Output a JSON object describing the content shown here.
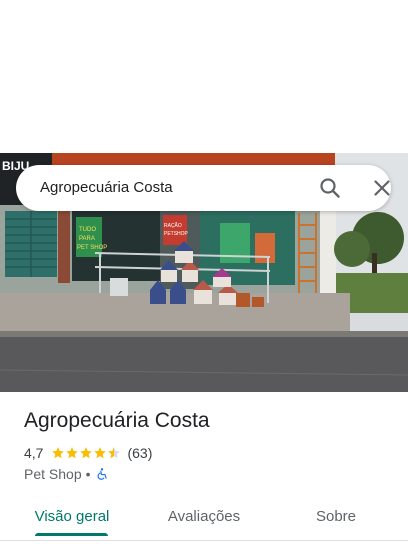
{
  "search": {
    "query": "Agropecuária Costa",
    "search_icon": "search-icon",
    "close_icon": "close-icon"
  },
  "photo": {
    "sign_text": "BIJU",
    "poster_lines": [
      "TUDO",
      "PARA",
      "PET SHOP"
    ],
    "poster_right_lines": [
      "RAÇÃO",
      "PETSHOP"
    ]
  },
  "place": {
    "title": "Agropecuária Costa",
    "rating": "4,7",
    "rating_value": 4.7,
    "review_count": "(63)",
    "category": "Pet Shop",
    "separator": "•",
    "accessibility_icon": "wheelchair-icon",
    "star_color": "#fbbc04"
  },
  "tabs": [
    {
      "label": "Visão geral",
      "active": true
    },
    {
      "label": "Avaliações",
      "active": false
    },
    {
      "label": "Sobre",
      "active": false
    }
  ],
  "colors": {
    "accent": "#00796b",
    "accessibility": "#1a73e8"
  }
}
